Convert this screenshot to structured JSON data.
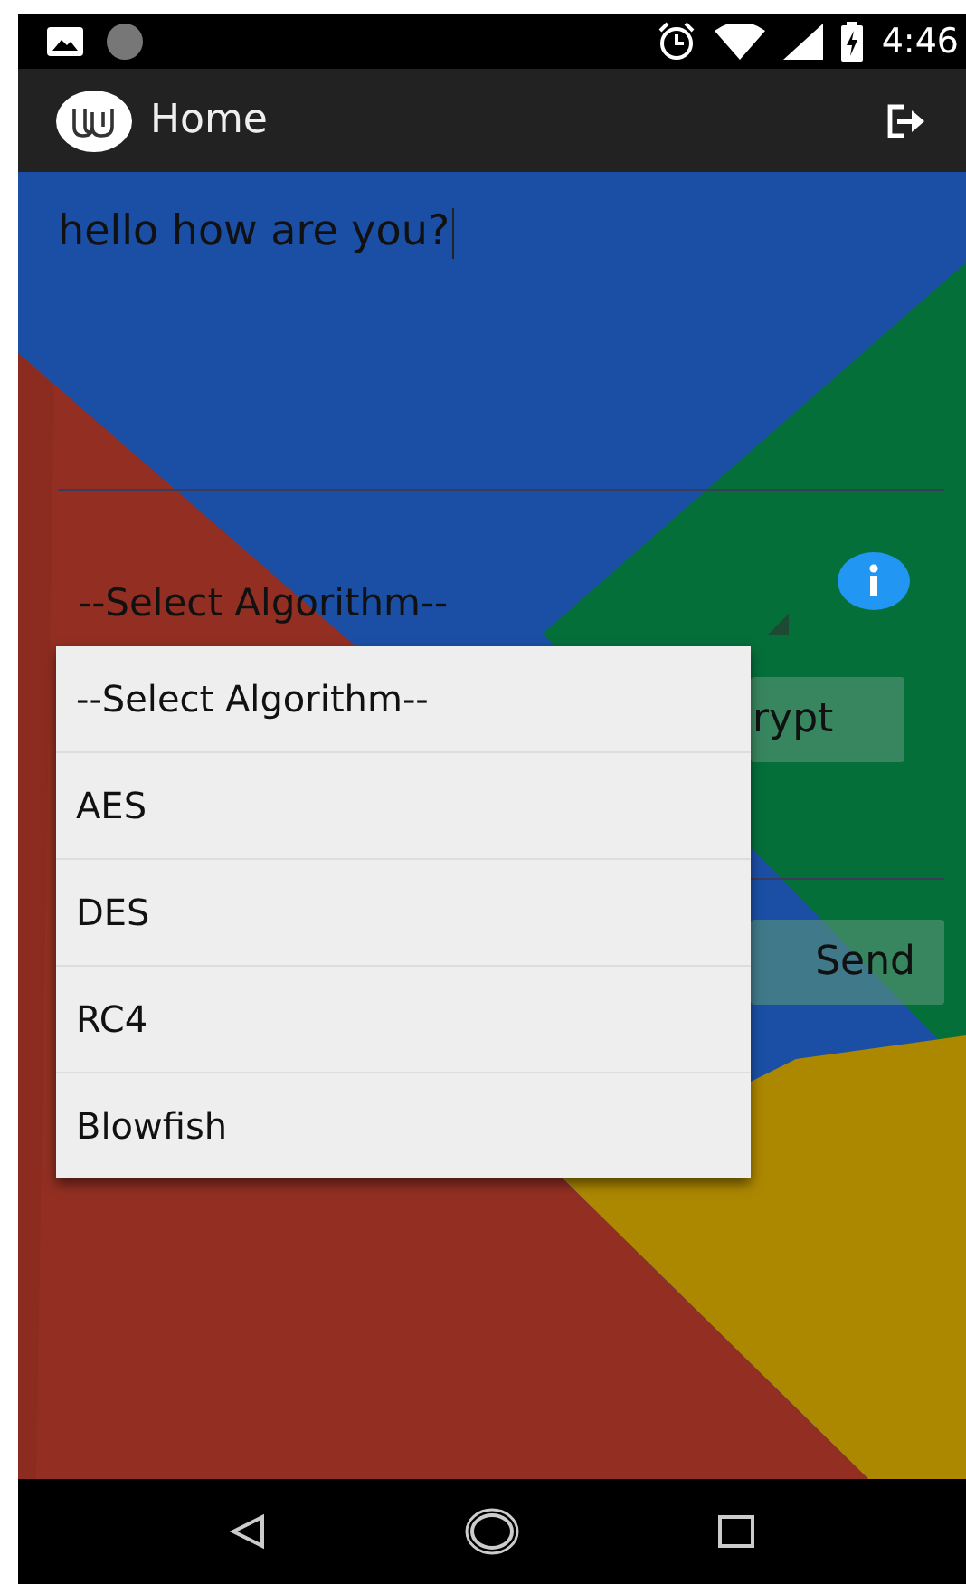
{
  "status_bar": {
    "time": "4:46"
  },
  "app_bar": {
    "title": "Home"
  },
  "message_field": {
    "value": "hello how are you?",
    "focused": true
  },
  "algorithm_spinner": {
    "value": "--Select Algorithm--",
    "expanded": true
  },
  "dropdown_items": [
    {
      "label": "--Select Algorithm--",
      "selected": false
    },
    {
      "label": "AES",
      "selected": false
    },
    {
      "label": "DES",
      "selected": false
    },
    {
      "label": "RC4",
      "selected": false
    },
    {
      "label": "Blowfish",
      "selected": false
    }
  ],
  "buttons": [
    {
      "label": "rypt"
    },
    {
      "label": "Send"
    }
  ]
}
